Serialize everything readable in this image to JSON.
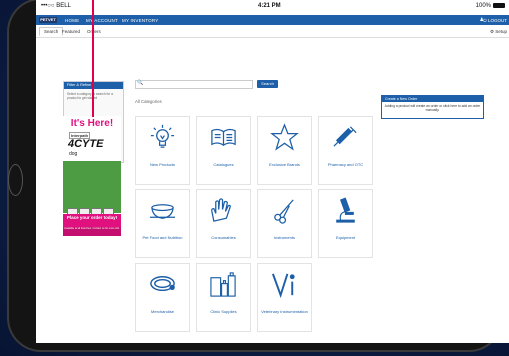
{
  "status_bar": {
    "carrier": "•••○○ BELL",
    "time": "4:21 PM",
    "battery": "100%"
  },
  "nav": {
    "logo": "PETVET",
    "links": [
      "HOME",
      "MY ACCOUNT",
      "MY INVENTORY"
    ],
    "logout": "LOGOUT"
  },
  "tabs": {
    "items": [
      "Search",
      "Featured",
      "Orders"
    ],
    "active": "Search",
    "setup": "Setup"
  },
  "filter_panel": {
    "title": "Filter & Refine",
    "text": "Select a category to search for a product to get started"
  },
  "search": {
    "placeholder": "",
    "button": "Search"
  },
  "categories_heading": "All Categories",
  "categories": [
    {
      "label": "New Products",
      "icon": "lightbulb-icon"
    },
    {
      "label": "Catalogues",
      "icon": "catalogue-icon"
    },
    {
      "label": "Exclusive Brands",
      "icon": "star-icon"
    },
    {
      "label": "Pharmacy and OTC",
      "icon": "syringe-icon"
    },
    {
      "label": "Pet Food and Nutrition",
      "icon": "pet-bowl-icon"
    },
    {
      "label": "Consumables",
      "icon": "gloves-icon"
    },
    {
      "label": "Instruments",
      "icon": "scissors-icon"
    },
    {
      "label": "Equipment",
      "icon": "microscope-icon"
    },
    {
      "label": "Merchandise",
      "icon": "collar-icon"
    },
    {
      "label": "Clinic Supplies",
      "icon": "bottles-icon"
    },
    {
      "label": "Veterinary Instrumentation",
      "icon": "vi-logo-icon"
    }
  ],
  "info_box": {
    "title": "Create a New Order",
    "text": "Adding a product will create an order or click here to add an order manually."
  },
  "ad": {
    "headline": "It's Here!",
    "brand": "Interpath",
    "product": "4CYTE",
    "dog": "dog",
    "cta": "Place your order today!",
    "footer": "Available at all branches. Contact us for more info."
  },
  "colors": {
    "brand_blue": "#1d5fa8",
    "ad_pink": "#e0117f",
    "pointer_red": "#e0004c"
  }
}
